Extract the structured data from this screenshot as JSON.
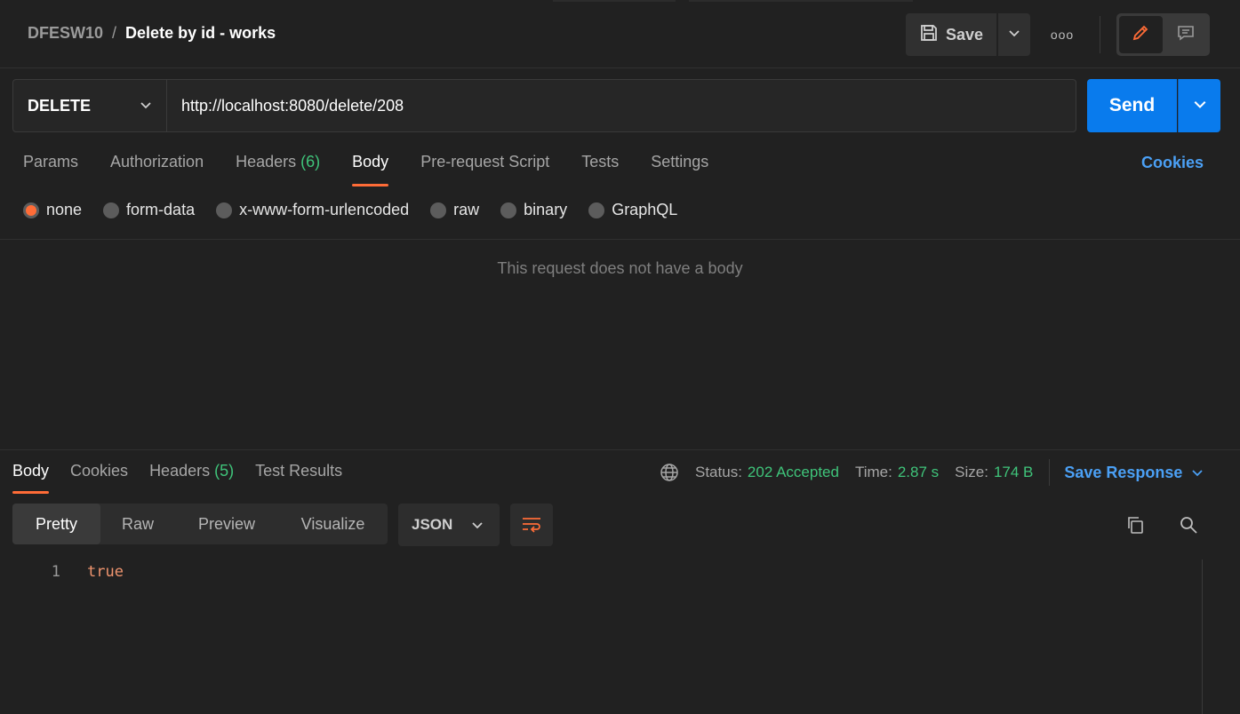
{
  "breadcrumb": {
    "parent": "DFESW10",
    "separator": "/",
    "current": "Delete by id - works"
  },
  "header": {
    "save_label": "Save",
    "more_label": "ooo"
  },
  "request": {
    "method": "DELETE",
    "url": "http://localhost:8080/delete/208",
    "send_label": "Send"
  },
  "request_tabs": {
    "params": "Params",
    "authorization": "Authorization",
    "headers": "Headers",
    "headers_count": "(6)",
    "body": "Body",
    "prerequest": "Pre-request Script",
    "tests": "Tests",
    "settings": "Settings",
    "cookies": "Cookies",
    "active": "Body"
  },
  "body_types": {
    "none": "none",
    "form_data": "form-data",
    "urlencoded": "x-www-form-urlencoded",
    "raw": "raw",
    "binary": "binary",
    "graphql": "GraphQL",
    "selected": "none"
  },
  "body_empty_message": "This request does not have a body",
  "response_tabs": {
    "body": "Body",
    "cookies": "Cookies",
    "headers": "Headers",
    "headers_count": "(5)",
    "test_results": "Test Results",
    "active": "Body"
  },
  "response_meta": {
    "status_label": "Status:",
    "status_value": "202 Accepted",
    "time_label": "Time:",
    "time_value": "2.87 s",
    "size_label": "Size:",
    "size_value": "174 B",
    "save_response": "Save Response"
  },
  "view_modes": {
    "pretty": "Pretty",
    "raw": "Raw",
    "preview": "Preview",
    "visualize": "Visualize",
    "active": "Pretty"
  },
  "format": "JSON",
  "response_body": [
    {
      "line": "1",
      "text": "true"
    }
  ],
  "colors": {
    "accent": "#ff6c37",
    "send": "#097bed",
    "link": "#4ba0f5",
    "success": "#3fc47a"
  }
}
